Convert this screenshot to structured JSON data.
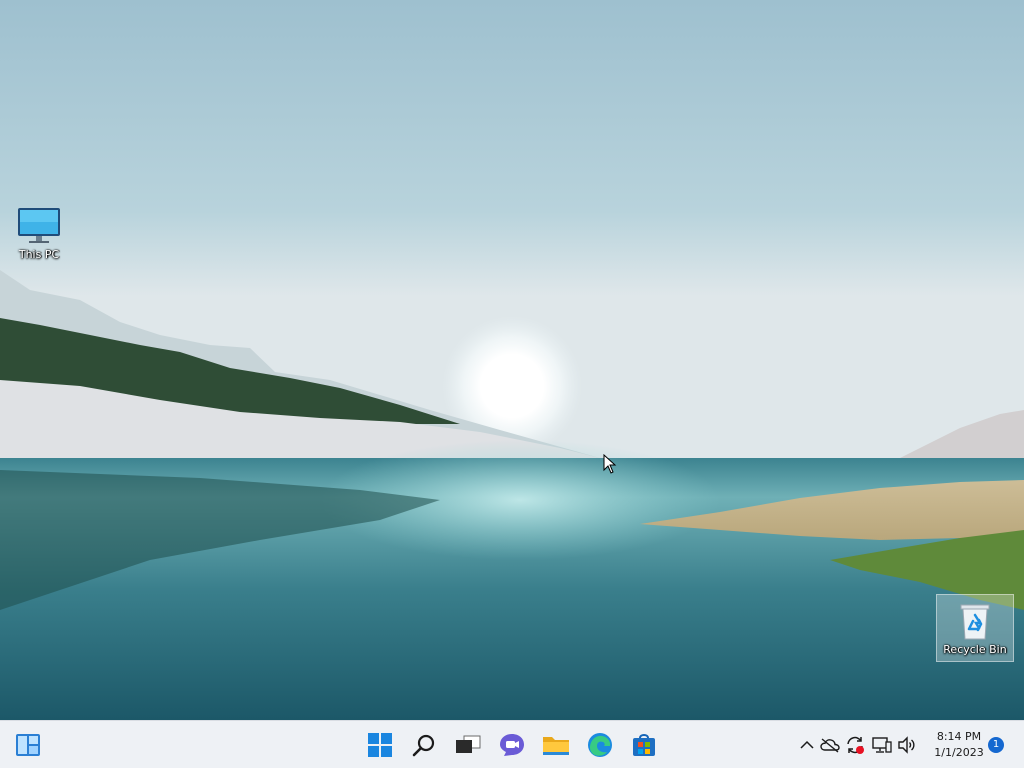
{
  "desktop": {
    "icons": [
      {
        "label": "This PC"
      },
      {
        "label": "Recycle Bin"
      }
    ]
  },
  "taskbar": {
    "pinned": [
      {
        "name": "widgets",
        "icon": "widgets-icon"
      },
      {
        "name": "start",
        "icon": "windows-logo-icon"
      },
      {
        "name": "search",
        "icon": "search-icon"
      },
      {
        "name": "task-view",
        "icon": "task-view-icon"
      },
      {
        "name": "chat",
        "icon": "chat-icon"
      },
      {
        "name": "file-explorer",
        "icon": "folder-icon"
      },
      {
        "name": "edge",
        "icon": "edge-icon"
      },
      {
        "name": "store",
        "icon": "store-icon"
      }
    ],
    "tray": {
      "icons": [
        "chevron-up-icon",
        "onedrive-icon",
        "sync-icon",
        "network-icon",
        "volume-icon"
      ]
    },
    "clock": {
      "time": "8:14 PM",
      "date": "1/1/2023"
    },
    "notification_count": "1"
  },
  "colors": {
    "accent": "#0067c0",
    "taskbar_bg": "#eef1f5",
    "badge": "#1568d0"
  }
}
